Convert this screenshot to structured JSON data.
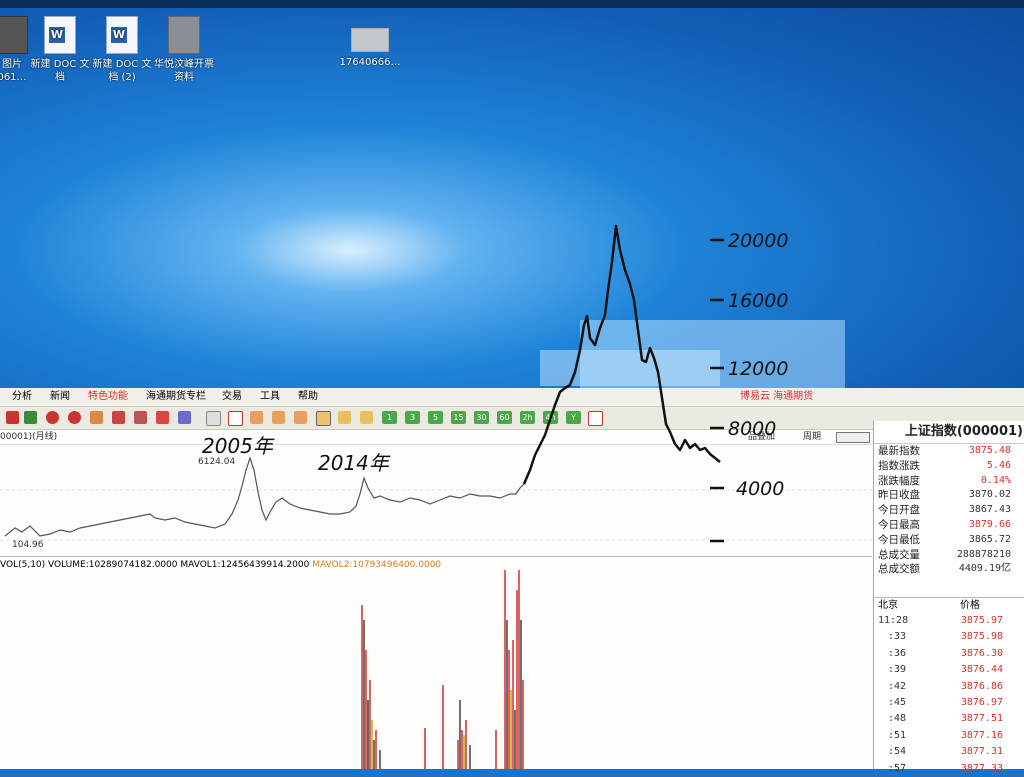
{
  "desktop": {
    "icons": [
      {
        "label": "图片\n061…",
        "kind": "photo"
      },
      {
        "label": "新建 DOC 文\n档",
        "kind": "word"
      },
      {
        "label": "新建 DOC 文\n档 (2)",
        "kind": "word"
      },
      {
        "label": "华悦汶峰开票\n资料",
        "kind": "folder"
      },
      {
        "label": "17640666…",
        "kind": "thumbnail"
      }
    ]
  },
  "menu": {
    "items": [
      "分析",
      "新闻",
      "特色功能",
      "海通期货专栏",
      "交易",
      "工具",
      "帮助"
    ],
    "brand_right": "博易云 海通期货"
  },
  "toolbar": {
    "numbered_buttons": [
      "1",
      "3",
      "5",
      "15",
      "30",
      "60",
      "2h",
      "4h",
      "Y"
    ]
  },
  "chart": {
    "title": "00001)(月线)",
    "top_buttons": [
      "品叠加",
      "周期"
    ],
    "peak_label": "6124.04",
    "low_label": "104.96",
    "volume_line_main": "VOL(5,10) VOLUME:10289074182.0000 MAVOL1:12456439914.2000",
    "volume_line_mavol2": "MAVOL2:10793496400.0000"
  },
  "annotations": {
    "year_2005": "2005年",
    "year_2014": "2014年",
    "scale": [
      "20000",
      "16000",
      "12000",
      "8000",
      "4000"
    ]
  },
  "quote": {
    "title": "上证指数(000001)",
    "rows": [
      {
        "label": "最新指数",
        "value": "3875.48",
        "red": true
      },
      {
        "label": "指数涨跌",
        "value": "5.46",
        "red": true
      },
      {
        "label": "涨跌幅度",
        "value": "0.14%",
        "red": true
      },
      {
        "label": "昨日收盘",
        "value": "3870.02",
        "red": false
      },
      {
        "label": "今日开盘",
        "value": "3867.43",
        "red": false
      },
      {
        "label": "今日最高",
        "value": "3879.66",
        "red": true
      },
      {
        "label": "今日最低",
        "value": "3865.72",
        "red": false
      },
      {
        "label": "总成交量",
        "value": "288878210",
        "red": false
      },
      {
        "label": "总成交额",
        "value": "4409.19亿",
        "red": false
      }
    ],
    "tick_header": {
      "col1": "北京",
      "col2": "价格"
    },
    "ticks": [
      {
        "time": "11:28",
        "price": "3875.97"
      },
      {
        "time": ":33",
        "price": "3875.98"
      },
      {
        "time": ":36",
        "price": "3876.30"
      },
      {
        "time": ":39",
        "price": "3876.44"
      },
      {
        "time": ":42",
        "price": "3876.86"
      },
      {
        "time": ":45",
        "price": "3876.97"
      },
      {
        "time": ":48",
        "price": "3877.51"
      },
      {
        "time": ":51",
        "price": "3877.16"
      },
      {
        "time": ":54",
        "price": "3877.31"
      },
      {
        "time": ":57",
        "price": "3877.33"
      }
    ]
  },
  "colors": {
    "accent_red": "#d2342a",
    "price_line": "#555555",
    "ink": "#111111",
    "volume_red": "#d02020"
  }
}
